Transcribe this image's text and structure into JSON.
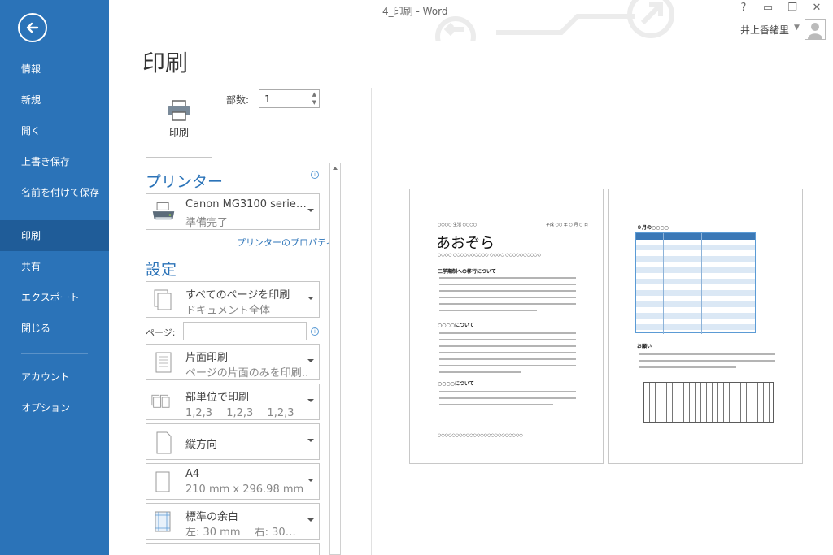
{
  "window": {
    "title": "4_印刷 - Word",
    "user": "井上香緒里",
    "controls": [
      "?",
      "▭",
      "❐",
      "✕"
    ]
  },
  "sidebar": {
    "items": [
      {
        "label": "情報"
      },
      {
        "label": "新規"
      },
      {
        "label": "開く"
      },
      {
        "label": "上書き保存"
      },
      {
        "label": "名前を付けて保存"
      },
      {
        "label": "印刷",
        "active": true
      },
      {
        "label": "共有"
      },
      {
        "label": "エクスポート"
      },
      {
        "label": "閉じる"
      },
      {
        "label": "アカウント"
      },
      {
        "label": "オプション"
      }
    ]
  },
  "print": {
    "title": "印刷",
    "print_button": "印刷",
    "copies_label": "部数:",
    "copies_value": "1",
    "printer_heading": "プリンター",
    "printer_name": "Canon MG3100 serie…",
    "printer_status": "準備完了",
    "printer_properties": "プリンターのプロパティ",
    "settings_heading": "設定",
    "settings": [
      {
        "l1": "すべてのページを印刷",
        "l2": "ドキュメント全体",
        "icon": "pages-icon"
      },
      {
        "l1": "片面印刷",
        "l2": "ページの片面のみを印刷…",
        "icon": "one-sided-icon"
      },
      {
        "l1": "部単位で印刷",
        "l2": "1,2,3　 1,2,3　 1,2,3",
        "icon": "collate-icon"
      },
      {
        "l1": "縦方向",
        "l2": "",
        "icon": "portrait-icon"
      },
      {
        "l1": "A4",
        "l2": "210 mm x 296.98 mm",
        "icon": "paper-size-icon"
      },
      {
        "l1": "標準の余白",
        "l2": "左:  30 mm　 右:  30…",
        "icon": "margins-icon"
      }
    ],
    "pages_label": "ページ:"
  },
  "preview": {
    "page1": {
      "header_left": "○○○○ 生活 ○○○○",
      "header_right": "平成 ○○ 年 ○ 月 ○ 日",
      "title": "あおぞら",
      "subtitle": "○○○○ ○○○○○○○○○○ ○○○○ ○○○○○○○○○○",
      "sections": [
        "二学期制への移行について",
        "○○○○について",
        "○○○○について"
      ],
      "footer": "○○○○○○○○○○○○○○○○○○○○○○○○"
    },
    "page2": {
      "heading": "９月の○○○○",
      "section": "お願い"
    }
  },
  "colors": {
    "sidebar": "#2b73b8",
    "sidebar_active": "#1f5c98",
    "accent": "#2b73b8"
  }
}
